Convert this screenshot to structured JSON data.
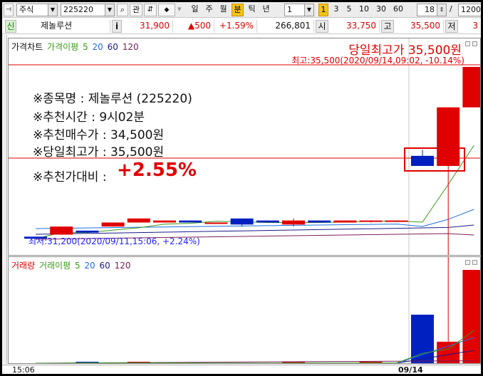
{
  "toolbar": {
    "market": "주식",
    "code": "225220",
    "btn_gwan": "관",
    "periods": [
      "일",
      "주",
      "월",
      "분",
      "틱",
      "년"
    ],
    "interval": "1",
    "minute_steps": [
      "1",
      "3",
      "5",
      "10",
      "30",
      "60"
    ],
    "count": "18",
    "slash": "/",
    "total": "1200"
  },
  "quote": {
    "badge": "신",
    "name": "제놀루션",
    "info_btn": "i",
    "price": "31,900",
    "change": "▲500",
    "change_pct": "+1.59%",
    "volume": "266,801",
    "open_label": "시",
    "open": "33,750",
    "high_label": "고",
    "high": "35,500",
    "low_label": "저",
    "low_partial": "3"
  },
  "price_panel": {
    "legend": [
      "가격차트",
      "가격이평",
      "5",
      "20",
      "60",
      "120"
    ],
    "headline": "당일최고가 35,500원",
    "high_annot": "최고:35,500(2020/09/14,09:02, -10.14%)",
    "low_annot": "최저:31,200(2020/09/11,15:06, +2.24%)",
    "info": [
      "※종목명 : 제놀루션 (225220)",
      "※추천시간 : 9시02분",
      "※추천매수가 : 34,500원",
      "※당일최고가 : 35,500원"
    ],
    "info_last_label": "※추천가대비 :",
    "info_last_value": "+2.55%"
  },
  "volume_panel": {
    "legend": [
      "거래량",
      "거래이평",
      "5",
      "20",
      "60",
      "120"
    ]
  },
  "xaxis": {
    "left_label": "15:06",
    "date_label": "09/14"
  },
  "colors": {
    "up": "#e10000",
    "down": "#0020c0",
    "ma5": "#3a9a1a",
    "ma20": "#1f6fe0",
    "ma60": "#1b1b8a",
    "ma120": "#7a1f5a"
  },
  "chart_data": {
    "type": "candlestick",
    "series": [
      {
        "name": "가격차트",
        "type": "candlestick",
        "ohlc": [
          [
            31300,
            31300,
            31250,
            31250
          ],
          [
            31350,
            31550,
            31350,
            31550
          ],
          [
            31450,
            31450,
            31400,
            31400
          ],
          [
            31550,
            31650,
            31550,
            31650
          ],
          [
            31650,
            31750,
            31650,
            31750
          ],
          [
            31650,
            31700,
            31650,
            31700
          ],
          [
            31700,
            31700,
            31650,
            31650
          ],
          [
            31650,
            31650,
            31650,
            31650
          ],
          [
            31750,
            31750,
            31550,
            31600
          ],
          [
            31700,
            31700,
            31650,
            31650
          ],
          [
            31600,
            31750,
            31550,
            31700
          ],
          [
            31700,
            31700,
            31650,
            31650
          ],
          [
            31650,
            31700,
            31650,
            31700
          ],
          [
            31700,
            31700,
            31650,
            31700
          ],
          [
            31700,
            31700,
            31700,
            31700
          ],
          [
            33300,
            33450,
            33300,
            33050
          ],
          [
            33050,
            34500,
            33050,
            34500
          ],
          [
            34500,
            35500,
            34500,
            35500
          ]
        ]
      },
      {
        "name": "거래량",
        "type": "bar",
        "values": [
          0,
          0,
          600,
          0,
          200,
          0,
          0,
          0,
          0,
          0,
          400,
          0,
          0,
          300,
          0,
          26000,
          11500,
          50000
        ]
      }
    ],
    "price_range": [
      31200,
      35500
    ],
    "grid": false
  }
}
